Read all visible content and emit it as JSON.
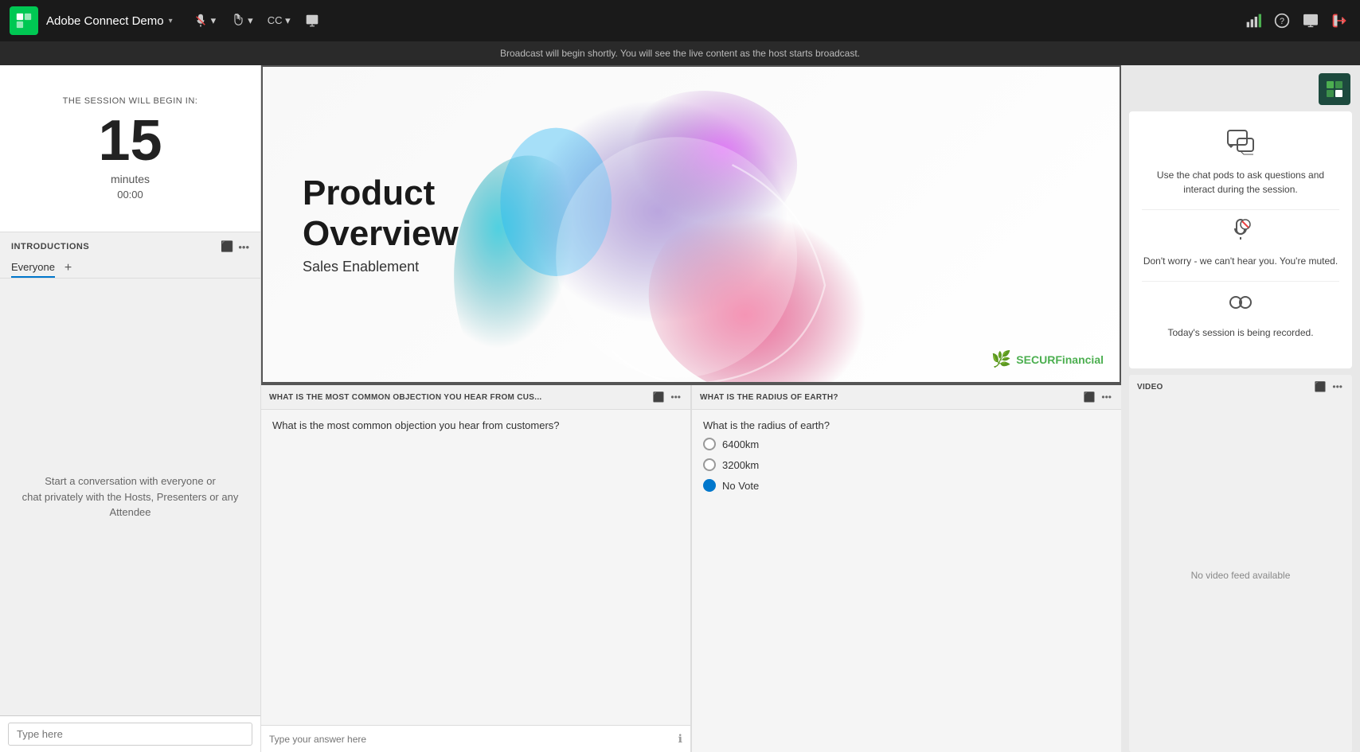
{
  "app": {
    "title": "Adobe Connect Demo",
    "dropdown_arrow": "▾"
  },
  "nav": {
    "mic_label": "▾",
    "hand_label": "▾",
    "cc_label": "CC ▾",
    "share_icon": "⧉"
  },
  "broadcast_bar": {
    "message": "Broadcast will begin shortly. You will see the live content as the host starts broadcast."
  },
  "timer": {
    "label": "THE SESSION WILL BEGIN IN:",
    "number": "15",
    "unit": "minutes",
    "clock": "00:00"
  },
  "introductions": {
    "title": "INTRODUCTIONS",
    "tab": "Everyone",
    "body_line1": "Start a conversation with everyone or",
    "body_line2": "chat privately with the Hosts, Presenters or any Attendee"
  },
  "chat_input": {
    "placeholder": "Type here"
  },
  "slide": {
    "title_line1": "Product",
    "title_line2": "Overview",
    "subtitle": "Sales Enablement",
    "logo_text": "SECUR",
    "logo_suffix": "Financial"
  },
  "qa_pod": {
    "title": "WHAT IS THE MOST COMMON OBJECTION YOU HEAR FROM CUS...",
    "question": "What is the most common objection you hear from customers?",
    "input_placeholder": "Type your answer here"
  },
  "poll_pod": {
    "title": "WHAT IS THE RADIUS OF EARTH?",
    "question": "What is the radius of earth?",
    "options": [
      {
        "label": "6400km",
        "selected": false
      },
      {
        "label": "3200km",
        "selected": false
      },
      {
        "label": "No Vote",
        "selected": true
      }
    ]
  },
  "info_card": {
    "chat_text": "Use the chat pods to ask questions and interact during the session.",
    "muted_text": "Don't worry - we can't hear you. You're muted.",
    "recording_text": "Today's session is being recorded."
  },
  "video_pod": {
    "title": "VIDEO",
    "no_feed": "No video feed available"
  }
}
